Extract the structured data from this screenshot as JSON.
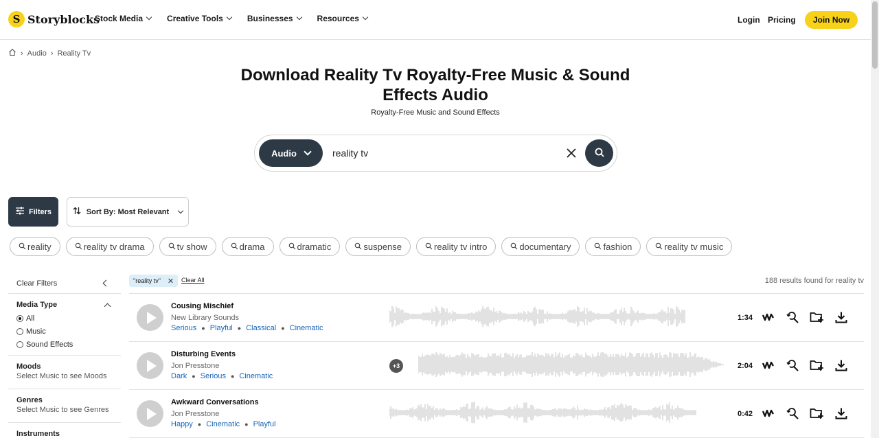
{
  "brand": {
    "name": "Storyblocks",
    "mark": "S",
    "accent": "#f8d21a",
    "dark": "#2d3945"
  },
  "nav": {
    "items": [
      {
        "label": "Stock Media"
      },
      {
        "label": "Creative Tools"
      },
      {
        "label": "Businesses"
      },
      {
        "label": "Resources"
      }
    ],
    "login": "Login",
    "pricing": "Pricing",
    "join": "Join Now"
  },
  "breadcrumb": {
    "items": [
      "Audio",
      "Reality Tv"
    ]
  },
  "page": {
    "title": "Download Reality Tv Royalty-Free Music & Sound Effects Audio",
    "subtitle": "Royalty-Free Music and Sound Effects"
  },
  "search": {
    "category": "Audio",
    "value": "reality tv"
  },
  "toolbar": {
    "filters": "Filters",
    "sort": "Sort By: Most Relevant"
  },
  "chips": [
    "reality",
    "reality tv drama",
    "tv show",
    "drama",
    "dramatic",
    "suspense",
    "reality tv intro",
    "documentary",
    "fashion",
    "reality tv music"
  ],
  "sidebar": {
    "clear_filters": "Clear Filters",
    "media_type": {
      "heading": "Media Type",
      "options": [
        {
          "label": "All",
          "selected": true
        },
        {
          "label": "Music",
          "selected": false
        },
        {
          "label": "Sound Effects",
          "selected": false
        }
      ]
    },
    "moods": {
      "heading": "Moods",
      "hint": "Select Music to see Moods"
    },
    "genres": {
      "heading": "Genres",
      "hint": "Select Music to see Genres"
    },
    "instruments": {
      "heading": "Instruments"
    }
  },
  "results": {
    "active_filter": "\"reality tv\"",
    "clear_all": "Clear All",
    "count_text": "188 results found for reality tv",
    "tracks": [
      {
        "title": "Cousing Mischief",
        "artist": "New Library Sounds",
        "tags": [
          "Serious",
          "Playful",
          "Classical",
          "Cinematic"
        ],
        "duration": "1:34",
        "extra": ""
      },
      {
        "title": "Disturbing Events",
        "artist": "Jon Presstone",
        "tags": [
          "Dark",
          "Serious",
          "Cinematic"
        ],
        "duration": "2:04",
        "extra": "+3"
      },
      {
        "title": "Awkward Conversations",
        "artist": "Jon Presstone",
        "tags": [
          "Happy",
          "Cinematic",
          "Playful"
        ],
        "duration": "0:42",
        "extra": ""
      }
    ]
  },
  "icons": {
    "home": "home-icon",
    "search": "search-icon",
    "close": "close-icon",
    "filters": "sliders-icon",
    "sort": "sort-arrows-icon",
    "similar": "waveform-similar-icon",
    "find_similar": "magnify-refresh-icon",
    "add_folder": "folder-plus-icon",
    "download": "download-icon"
  }
}
